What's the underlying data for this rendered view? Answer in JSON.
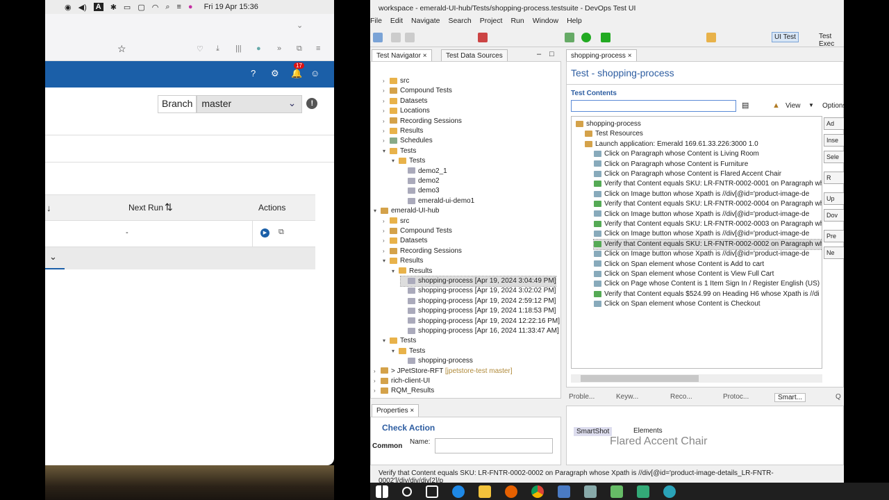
{
  "mac": {
    "clock": "Fri 19 Apr  15:36",
    "notif_count": "17",
    "branch_label": "Branch",
    "branch_value": "master",
    "col_next_run": "Next Run",
    "col_actions": "Actions",
    "row_next_run": "-"
  },
  "rft": {
    "title": "workspace - emerald-UI-hub/Tests/shopping-process.testsuite - DevOps Test UI",
    "menu": [
      "File",
      "Edit",
      "Navigate",
      "Search",
      "Project",
      "Run",
      "Window",
      "Help"
    ],
    "perspectives": [
      "UI Test",
      "Test Exec"
    ],
    "nav_tabs": [
      "Test Navigator",
      "Test Data Sources"
    ],
    "tree": [
      {
        "lvl": 1,
        "t": "src",
        "a": ">"
      },
      {
        "lvl": 1,
        "t": "Compound Tests",
        "a": ">"
      },
      {
        "lvl": 1,
        "t": "Datasets",
        "a": ">"
      },
      {
        "lvl": 1,
        "t": "Locations",
        "a": ">"
      },
      {
        "lvl": 1,
        "t": "Recording Sessions",
        "a": ">"
      },
      {
        "lvl": 1,
        "t": "Results",
        "a": ">"
      },
      {
        "lvl": 1,
        "t": "Schedules",
        "a": ">"
      },
      {
        "lvl": 1,
        "t": "Tests",
        "a": "v"
      },
      {
        "lvl": 2,
        "t": "Tests",
        "a": "v"
      },
      {
        "lvl": 3,
        "t": "demo2_1",
        "a": ""
      },
      {
        "lvl": 3,
        "t": "demo2",
        "a": ""
      },
      {
        "lvl": 3,
        "t": "demo3",
        "a": ""
      },
      {
        "lvl": 3,
        "t": "emerald-ui-demo1",
        "a": ""
      },
      {
        "lvl": 0,
        "t": "emerald-UI-hub",
        "a": "v"
      },
      {
        "lvl": 1,
        "t": "src",
        "a": ">"
      },
      {
        "lvl": 1,
        "t": "Compound Tests",
        "a": ">"
      },
      {
        "lvl": 1,
        "t": "Datasets",
        "a": ">"
      },
      {
        "lvl": 1,
        "t": "Recording Sessions",
        "a": ">"
      },
      {
        "lvl": 1,
        "t": "Results",
        "a": "v"
      },
      {
        "lvl": 2,
        "t": "Results",
        "a": "v"
      },
      {
        "lvl": 3,
        "t": "shopping-process [Apr 19, 2024 3:04:49 PM]",
        "a": "",
        "sel": true
      },
      {
        "lvl": 3,
        "t": "shopping-process [Apr 19, 2024 3:02:02 PM]",
        "a": ""
      },
      {
        "lvl": 3,
        "t": "shopping-process [Apr 19, 2024 2:59:12 PM]",
        "a": ""
      },
      {
        "lvl": 3,
        "t": "shopping-process [Apr 19, 2024 1:18:53 PM]",
        "a": ""
      },
      {
        "lvl": 3,
        "t": "shopping-process [Apr 19, 2024 12:22:16 PM]",
        "a": ""
      },
      {
        "lvl": 3,
        "t": "shopping-process [Apr 16, 2024 11:33:47 AM]",
        "a": ""
      },
      {
        "lvl": 1,
        "t": "Tests",
        "a": "v"
      },
      {
        "lvl": 2,
        "t": "Tests",
        "a": "v"
      },
      {
        "lvl": 3,
        "t": "shopping-process",
        "a": ""
      },
      {
        "lvl": 0,
        "t": "> JPetStore-RFT",
        "a": ">",
        "extra": "[jpetstore-test master]"
      },
      {
        "lvl": 0,
        "t": "rich-client-UI",
        "a": ">"
      },
      {
        "lvl": 0,
        "t": "RQM_Results",
        "a": ">"
      }
    ],
    "editor_tab": "shopping-process",
    "editor_title": "Test - shopping-process",
    "test_contents": "Test Contents",
    "view_label": "View",
    "options_label": "Options",
    "steps": [
      {
        "lvl": 0,
        "t": "shopping-process"
      },
      {
        "lvl": 1,
        "t": "Test Resources"
      },
      {
        "lvl": 1,
        "t": "Launch application: Emerald 169.61.33.226:3000  1.0"
      },
      {
        "lvl": 2,
        "t": "Click on Paragraph whose Content is Living Room"
      },
      {
        "lvl": 2,
        "t": "Click on Paragraph whose Content is Furniture"
      },
      {
        "lvl": 2,
        "t": "Click on Paragraph whose Content is Flared Accent Chair"
      },
      {
        "lvl": 2,
        "t": "Verify that Content equals SKU: LR-FNTR-0002-0001 on Paragraph wh"
      },
      {
        "lvl": 2,
        "t": "Click on Image button whose Xpath is //div[@id='product-image-de"
      },
      {
        "lvl": 2,
        "t": "Verify that Content equals SKU: LR-FNTR-0002-0004 on Paragraph wh"
      },
      {
        "lvl": 2,
        "t": "Click on Image button whose Xpath is //div[@id='product-image-de"
      },
      {
        "lvl": 2,
        "t": "Verify that Content equals SKU: LR-FNTR-0002-0003 on Paragraph wh"
      },
      {
        "lvl": 2,
        "t": "Click on Image button whose Xpath is //div[@id='product-image-de"
      },
      {
        "lvl": 2,
        "t": "Verify that Content equals SKU: LR-FNTR-0002-0002 on Paragraph wh",
        "sel": true
      },
      {
        "lvl": 2,
        "t": "Click on Image button whose Xpath is //div[@id='product-image-de"
      },
      {
        "lvl": 2,
        "t": "Click on Span element whose Content is Add to cart"
      },
      {
        "lvl": 2,
        "t": "Click on Span element whose Content is View Full Cart"
      },
      {
        "lvl": 2,
        "t": "Click on Page whose Content is  1 Item Sign In / Register English (US)"
      },
      {
        "lvl": 2,
        "t": "Verify that Content equals $524.99 on Heading H6 whose Xpath is //di"
      },
      {
        "lvl": 2,
        "t": "Click on Span element whose Content is Checkout"
      }
    ],
    "side_buttons": [
      "Ad",
      "Inse",
      "Sele",
      "R",
      "Up",
      "Dov",
      "Pre",
      "Ne"
    ],
    "bottom_tabs": [
      "Proble...",
      "Keyw...",
      "Reco...",
      "Protoc...",
      "Smart...",
      "Q"
    ],
    "smartshot_tabs": [
      "SmartShot",
      "Elements"
    ],
    "smartshot_ghost": "Flared Accent Chair",
    "props_tab": "Properties",
    "props_title": "Check Action",
    "props_common": "Common",
    "props_name": "Name:",
    "status": "Verify that Content equals SKU: LR-FNTR-0002-0002 on Paragraph whose Xpath is //div[@id='product-image-details_LR-FNTR-0002']/div/div/div[2]/p"
  }
}
